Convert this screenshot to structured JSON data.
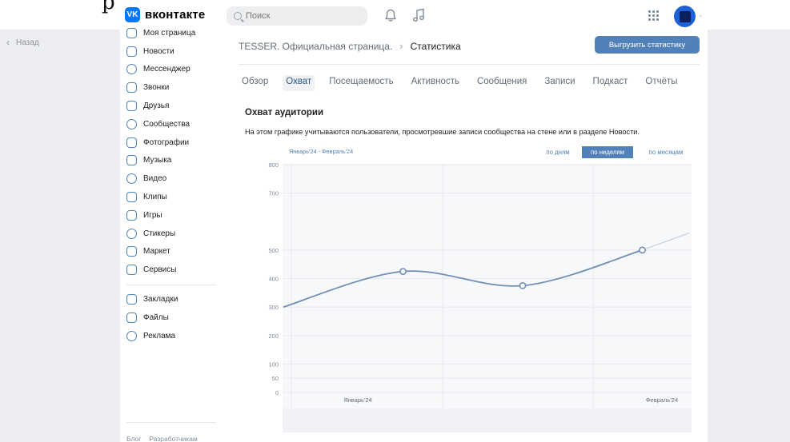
{
  "top_cut_text": "р",
  "back_label": "Назад",
  "header": {
    "logo_text": "вконтакте",
    "logo_badge": "VK",
    "search_placeholder": "Поиск"
  },
  "sidebar": {
    "items": [
      {
        "label": "Моя страница",
        "icon": "user-circle-icon"
      },
      {
        "label": "Новости",
        "icon": "news-icon"
      },
      {
        "label": "Мессенджер",
        "icon": "message-icon"
      },
      {
        "label": "Звонки",
        "icon": "phone-icon"
      },
      {
        "label": "Друзья",
        "icon": "friends-icon"
      },
      {
        "label": "Сообщества",
        "icon": "communities-icon"
      },
      {
        "label": "Фотографии",
        "icon": "photo-icon"
      },
      {
        "label": "Музыка",
        "icon": "music-icon"
      },
      {
        "label": "Видео",
        "icon": "video-icon"
      },
      {
        "label": "Клипы",
        "icon": "clips-icon"
      },
      {
        "label": "Игры",
        "icon": "gamepad-icon"
      },
      {
        "label": "Стикеры",
        "icon": "sticker-icon"
      },
      {
        "label": "Маркет",
        "icon": "market-icon"
      },
      {
        "label": "Сервисы",
        "icon": "services-icon"
      }
    ],
    "items2": [
      {
        "label": "Закладки",
        "icon": "bookmark-icon"
      },
      {
        "label": "Файлы",
        "icon": "file-icon"
      },
      {
        "label": "Реклама",
        "icon": "megaphone-icon"
      }
    ],
    "footer": [
      "Блог",
      "Разработчикам"
    ]
  },
  "main": {
    "breadcrumb_1": "TESSER. Официальная страница.",
    "breadcrumb_2": "Статистика",
    "export_label": "Выгрузить статистику",
    "tabs": [
      "Обзор",
      "Охват",
      "Посещаемость",
      "Активность",
      "Сообщения",
      "Записи",
      "Подкаст",
      "Отчёты"
    ],
    "active_tab": "Охват",
    "section_title": "Охват аудитории",
    "section_desc": "На этом графике учитываются пользователи, просмотревшие записи сообщества на стене или в разделе Новости.",
    "period": "Январь'24 - Февраль'24",
    "granularity": [
      "по дням",
      "по неделям",
      "по месяцам"
    ],
    "granularity_active": "по неделям"
  },
  "colors": {
    "accent": "#5181b8",
    "line": "#6f8eb5",
    "grid": "#e7e8ec",
    "plot_bg": "#f7f8fa"
  },
  "chart_data": {
    "type": "line",
    "ylim": [
      0,
      800
    ],
    "yticks": [
      0,
      50,
      100,
      200,
      300,
      400,
      500,
      700,
      800
    ],
    "x_tick_labels": [
      "Январь'24",
      "Февраль'24"
    ],
    "series": [
      {
        "points": [
          {
            "x": 0,
            "y": 300
          },
          {
            "x": 1,
            "y": 425
          },
          {
            "x": 2,
            "y": 375
          },
          {
            "x": 3,
            "y": 500
          },
          {
            "x": 3.5,
            "y": 560
          }
        ]
      }
    ]
  }
}
